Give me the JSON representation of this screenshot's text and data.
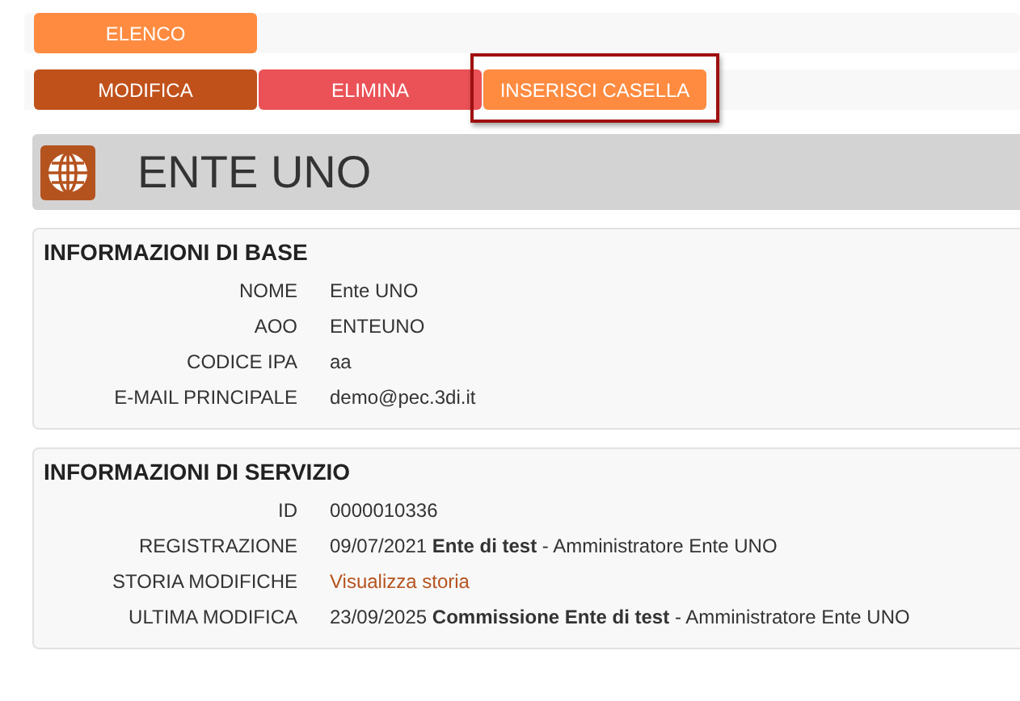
{
  "top_button": {
    "label": "ELENCO"
  },
  "actions": [
    {
      "label": "MODIFICA",
      "kind": "edit",
      "highlighted": false
    },
    {
      "label": "ELIMINA",
      "kind": "delete",
      "highlighted": false
    },
    {
      "label": "INSERISCI CASELLA",
      "kind": "add",
      "highlighted": true
    }
  ],
  "header": {
    "title": "ENTE UNO"
  },
  "sections": [
    {
      "title": "INFORMAZIONI DI BASE",
      "rows": [
        {
          "label": "NOME",
          "value": "Ente UNO",
          "kind": "text"
        },
        {
          "label": "AOO",
          "value": "ENTEUNO",
          "kind": "text"
        },
        {
          "label": "CODICE IPA",
          "value": "aa",
          "kind": "text"
        },
        {
          "label": "E-MAIL PRINCIPALE",
          "value": "demo@pec.3di.it",
          "kind": "text"
        }
      ]
    },
    {
      "title": "INFORMAZIONI DI SERVIZIO",
      "rows": [
        {
          "label": "ID",
          "value": "0000010336",
          "kind": "text"
        },
        {
          "label": "REGISTRAZIONE",
          "value": "09/07/2021 **Ente di test** - Amministratore Ente UNO",
          "kind": "text"
        },
        {
          "label": "STORIA MODIFICHE",
          "value": "Visualizza storia",
          "kind": "link"
        },
        {
          "label": "ULTIMA MODIFICA",
          "value": "23/09/2025 **Commissione Ente di test** - Amministratore Ente UNO",
          "kind": "text"
        }
      ]
    }
  ]
}
